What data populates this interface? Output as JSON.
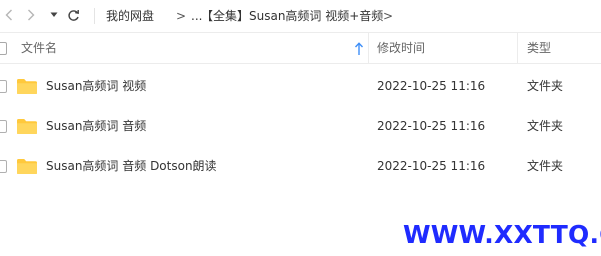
{
  "toolbar": {
    "breadcrumb": [
      "我的网盘",
      "...",
      "【全集】Susan高频词 视频+音频"
    ],
    "separator": ">"
  },
  "header": {
    "name_label": "文件名",
    "modified_label": "修改时间",
    "type_label": "类型"
  },
  "files": [
    {
      "name": "Susan高频词 视频",
      "modified": "2022-10-25 11:16",
      "type": "文件夹"
    },
    {
      "name": "Susan高频词 音频",
      "modified": "2022-10-25 11:16",
      "type": "文件夹"
    },
    {
      "name": "Susan高频词 音频 Dotson朗读",
      "modified": "2022-10-25 11:16",
      "type": "文件夹"
    }
  ],
  "watermark": "WWW.XXTTQ.COM",
  "colors": {
    "folder": "#ffc93c",
    "watermark": "#1f2bff",
    "sort_arrow": "#3d8ef7"
  },
  "icons": [
    "back-arrow-icon",
    "forward-arrow-icon",
    "dropdown-arrow-icon",
    "refresh-icon",
    "sort-ascending-icon",
    "folder-icon"
  ]
}
